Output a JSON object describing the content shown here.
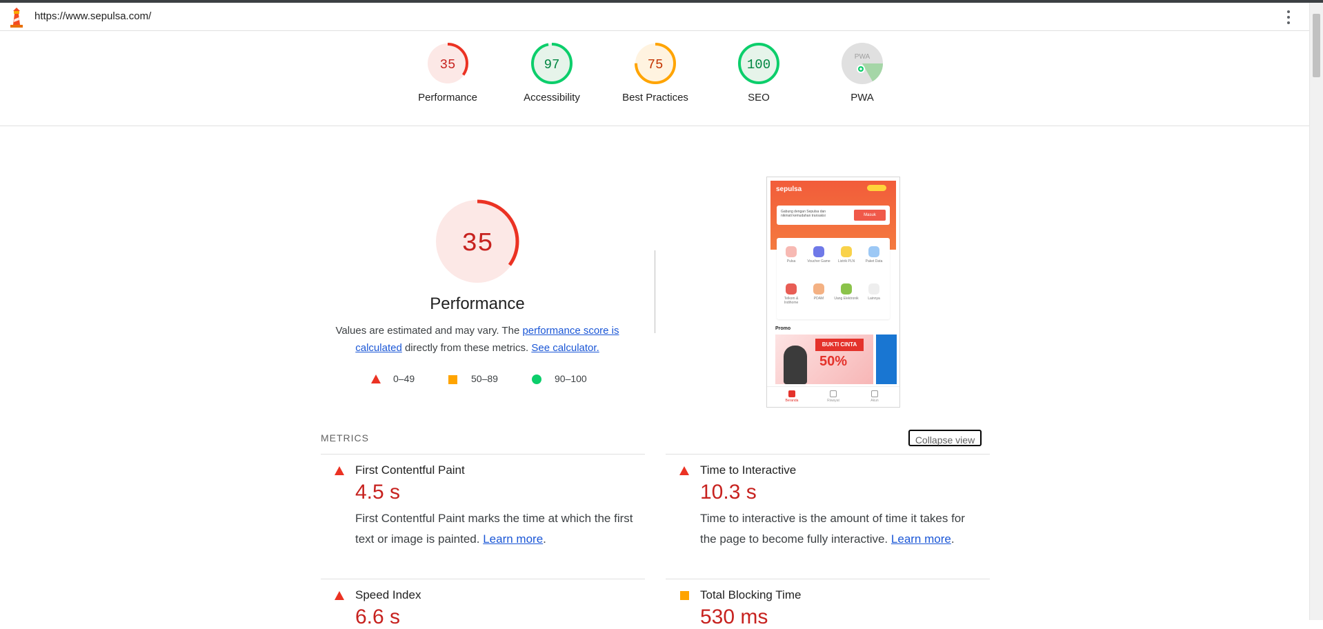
{
  "topbar": {
    "url": "https://www.sepulsa.com/"
  },
  "colors": {
    "fail": "#eb3223",
    "average": "#ffa400",
    "pass": "#0cce6b",
    "link": "#1a56d6"
  },
  "categories": [
    {
      "score": "35",
      "label": "Performance",
      "level": 0.35,
      "color": "#eb3223"
    },
    {
      "score": "97",
      "label": "Accessibility",
      "level": 0.97,
      "color": "#0cce6b"
    },
    {
      "score": "75",
      "label": "Best Practices",
      "level": 0.75,
      "color": "#ffa400"
    },
    {
      "score": "100",
      "label": "SEO",
      "level": 1.0,
      "color": "#0cce6b"
    },
    {
      "score": "PWA",
      "label": "PWA",
      "color": "#9e9e9e"
    }
  ],
  "performance": {
    "score": "35",
    "level": 0.35,
    "title": "Performance",
    "desc_before": "Values are estimated and may vary. The ",
    "desc_link": "performance score is calculated",
    "desc_middle": " directly from these metrics. ",
    "desc_link2": "See calculator.",
    "legend": [
      {
        "range": "0–49",
        "shape": "triangle"
      },
      {
        "range": "50–89",
        "shape": "square"
      },
      {
        "range": "90–100",
        "shape": "circle"
      }
    ]
  },
  "screenshot": {
    "brand": "sepulsa",
    "card_text": "Gabung dengan Sepulsa dan nikmati kemudahan transaksi",
    "card_button": "Masuk",
    "services": [
      "Pulsa",
      "Voucher Game",
      "Listrik PLN",
      "Paket Data",
      "Telkom & Indihome",
      "PDAM",
      "Uang Elektronik",
      "Lainnya"
    ],
    "promo_title": "Promo",
    "banner_caption": "BUKTI CINTA",
    "banner_pct": "50%",
    "tabs": [
      "Beranda",
      "Riwayat",
      "Akun"
    ]
  },
  "metrics": {
    "title": "METRICS",
    "collapse_label": "Collapse view",
    "items": [
      {
        "name": "First Contentful Paint",
        "value": "4.5 s",
        "shape": "triangle",
        "desc": "First Contentful Paint marks the time at which the first text or image is painted.",
        "link": "Learn more"
      },
      {
        "name": "Time to Interactive",
        "value": "10.3 s",
        "shape": "triangle",
        "desc": "Time to interactive is the amount of time it takes for the page to become fully interactive.",
        "link": "Learn more"
      },
      {
        "name": "Speed Index",
        "value": "6.6 s",
        "shape": "triangle"
      },
      {
        "name": "Total Blocking Time",
        "value": "530 ms",
        "shape": "square"
      }
    ]
  }
}
